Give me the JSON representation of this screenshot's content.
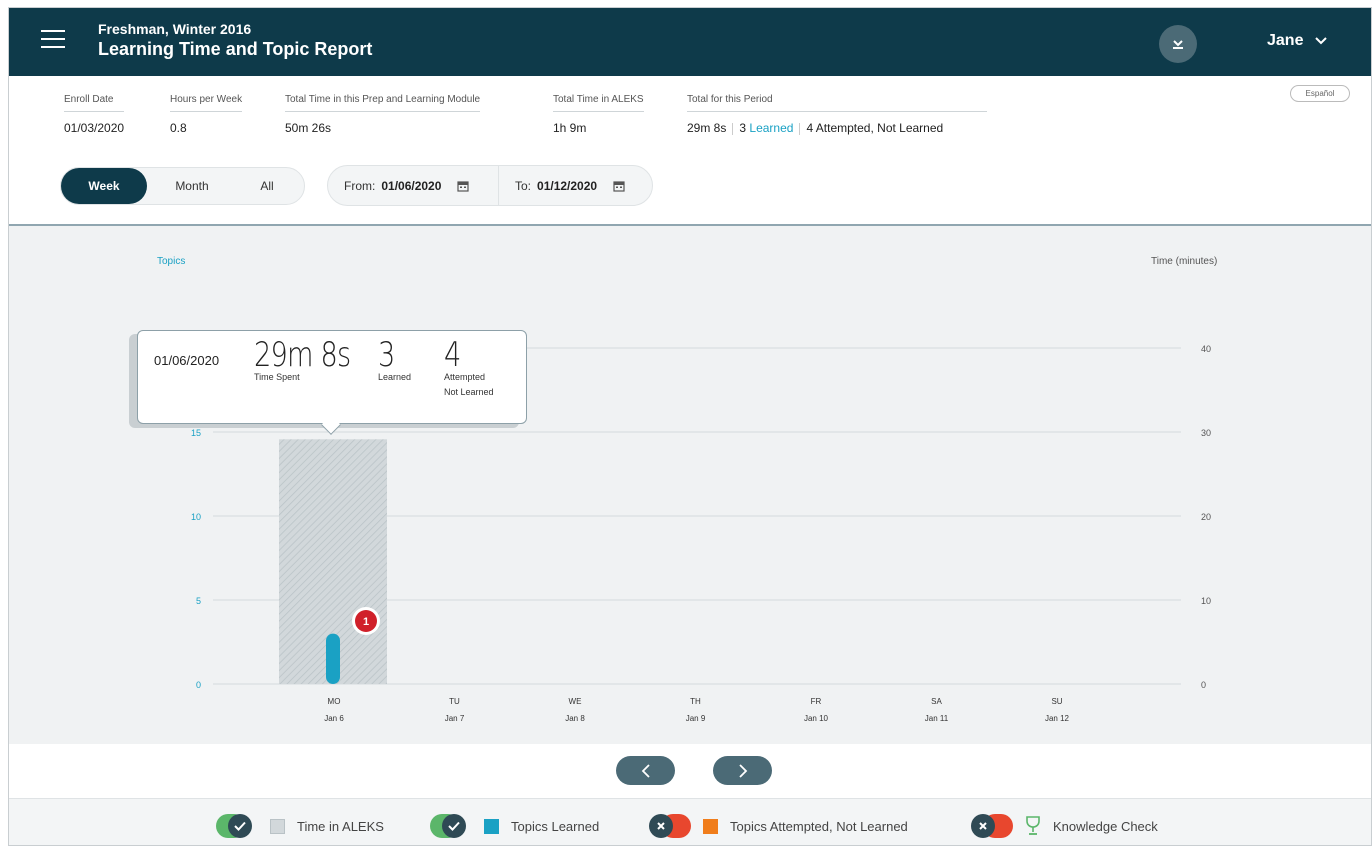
{
  "header": {
    "subtitle": "Freshman, Winter 2016",
    "title": "Learning Time and Topic Report",
    "user_name": "Jane"
  },
  "info": {
    "enroll_date_label": "Enroll Date",
    "enroll_date": "01/03/2020",
    "hours_per_week_label": "Hours per Week",
    "hours_per_week": "0.8",
    "total_module_label": "Total Time in this Prep and Learning Module",
    "total_module": "50m 26s",
    "total_aleks_label": "Total Time in ALEKS",
    "total_aleks": "1h 9m",
    "period_label": "Total for this Period",
    "period_time": "29m 8s",
    "period_learned_count": "3",
    "period_learned_label": "Learned",
    "period_attempted": "4 Attempted, Not Learned"
  },
  "language_button": "Español",
  "range_tabs": [
    "Week",
    "Month",
    "All"
  ],
  "active_tab": "Week",
  "date_range": {
    "from_label": "From:",
    "from_value": "01/06/2020",
    "to_label": "To:",
    "to_value": "01/12/2020"
  },
  "tooltip": {
    "date": "01/06/2020",
    "time_spent": "29m 8s",
    "time_spent_label": "Time Spent",
    "learned": "3",
    "learned_label": "Learned",
    "attempted": "4",
    "attempted_label_1": "Attempted",
    "attempted_label_2": "Not Learned"
  },
  "legend": {
    "time_in_aleks": "Time in ALEKS",
    "topics_learned": "Topics Learned",
    "topics_attempted": "Topics Attempted, Not Learned",
    "knowledge_check": "Knowledge Check"
  },
  "colors": {
    "header_bg": "#0e3a4a",
    "accent_blue": "#1aa1c4",
    "toggle_on": "#5bb66a",
    "toggle_off": "#e8472e",
    "attempted_orange": "#f07d1b",
    "knowledge_green": "#5bb66a",
    "badge_red": "#d0202a"
  },
  "chart_data": {
    "type": "bar",
    "ylabel": "Topics",
    "y2label": "Time (minutes)",
    "ylim": [
      0,
      20
    ],
    "y2lim": [
      0,
      40
    ],
    "yticks": [
      0,
      5,
      10,
      15
    ],
    "y2ticks": [
      0,
      10,
      20,
      30,
      40
    ],
    "categories": [
      {
        "day": "MO",
        "date": "Jan 6"
      },
      {
        "day": "TU",
        "date": "Jan 7"
      },
      {
        "day": "WE",
        "date": "Jan 8"
      },
      {
        "day": "TH",
        "date": "Jan 9"
      },
      {
        "day": "FR",
        "date": "Jan 10"
      },
      {
        "day": "SA",
        "date": "Jan 11"
      },
      {
        "day": "SU",
        "date": "Jan 12"
      }
    ],
    "series": [
      {
        "name": "Time in ALEKS",
        "axis": "right",
        "values": [
          29.13,
          0,
          0,
          0,
          0,
          0,
          0
        ]
      },
      {
        "name": "Topics Learned",
        "axis": "left",
        "values": [
          3,
          0,
          0,
          0,
          0,
          0,
          0
        ]
      }
    ],
    "knowledge_check_badges": [
      {
        "category": "MO",
        "count": "1"
      }
    ]
  }
}
